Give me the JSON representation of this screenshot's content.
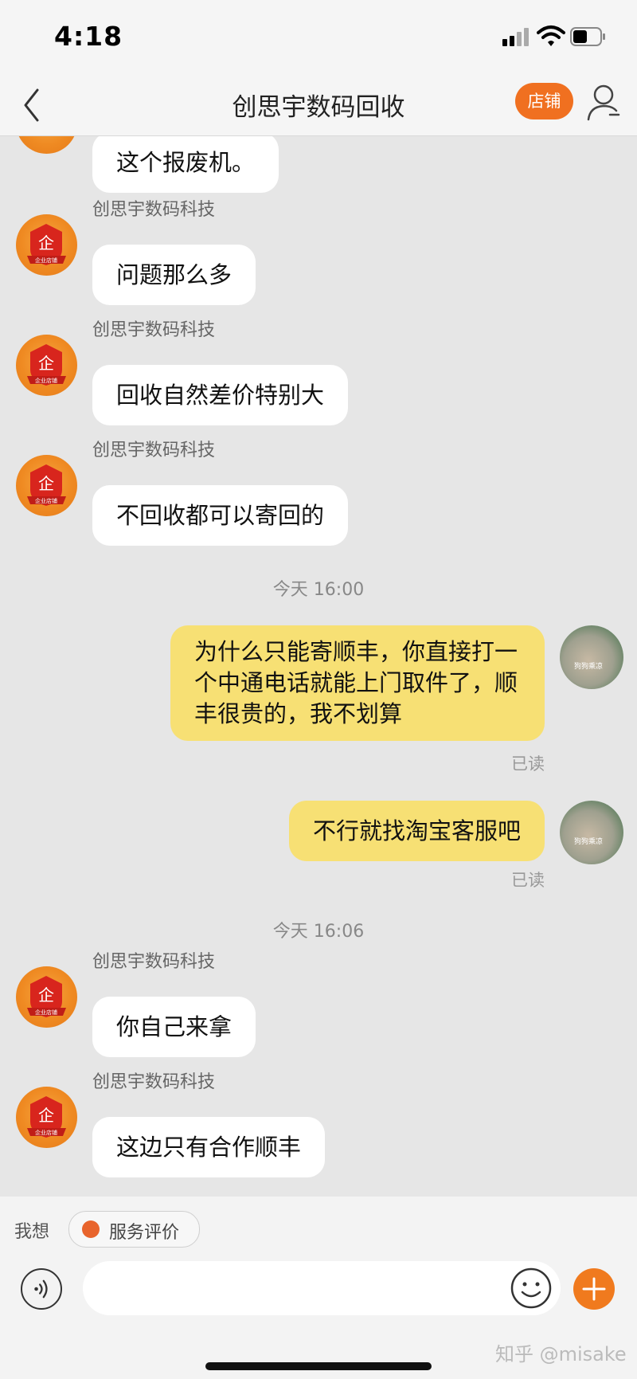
{
  "status_bar": {
    "time": "4:18"
  },
  "header": {
    "title": "创思宇数码回收",
    "shop_label": "店铺",
    "back_icon": "chevron-left-icon",
    "profile_icon": "user-icon"
  },
  "colors": {
    "accent": "#f07020",
    "bubble_out": "#f7e074",
    "bubble_in": "#ffffff",
    "background": "#e6e6e6"
  },
  "messages": {
    "m0": {
      "text": "这个报废机。"
    },
    "m1": {
      "sender": "创思宇数码科技",
      "text": "问题那么多"
    },
    "m2": {
      "sender": "创思宇数码科技",
      "text": "回收自然差价特别大"
    },
    "m3": {
      "sender": "创思宇数码科技",
      "text": "不回收都可以寄回的"
    },
    "t1": "今天 16:00",
    "m4": {
      "text": "为什么只能寄顺丰，你直接打一个中通电话就能上门取件了，顺丰很贵的，我不划算",
      "status": "已读"
    },
    "m5": {
      "text": "不行就找淘宝客服吧",
      "status": "已读"
    },
    "t2": "今天 16:06",
    "m6": {
      "sender": "创思宇数码科技",
      "text": "你自己来拿"
    },
    "m7": {
      "sender": "创思宇数码科技",
      "text": "这边只有合作顺丰"
    }
  },
  "avatar": {
    "shop_badge": "企",
    "shop_ribbon": "企业店铺",
    "user_caption": "狗狗乘凉"
  },
  "suggest": {
    "label": "我想",
    "chip": "服务评价"
  },
  "input": {
    "placeholder": ""
  },
  "watermark": "知乎 @misake"
}
